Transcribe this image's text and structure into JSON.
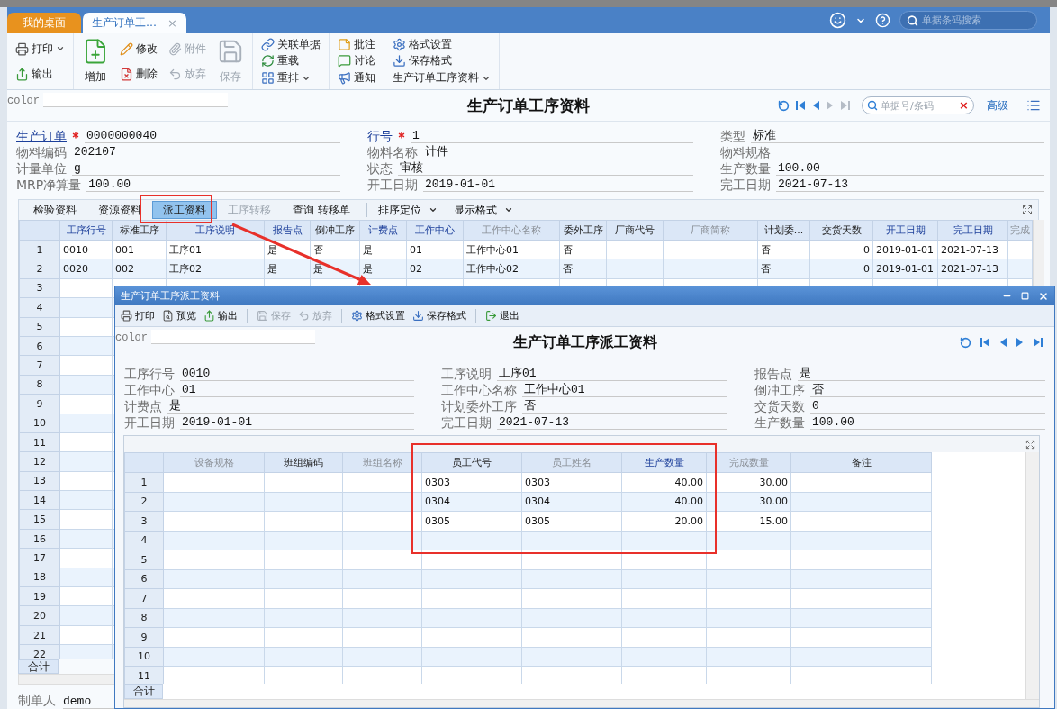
{
  "tabs": [
    {
      "label": "我的桌面",
      "selected": false
    },
    {
      "label": "生产订单工…",
      "selected": true,
      "close": "×"
    }
  ],
  "top_search": {
    "placeholder": "单据条码搜索"
  },
  "ribbon": [
    {
      "columns": [
        [
          {
            "label": "打印",
            "kind": "small",
            "disabled": false,
            "menu": true
          },
          {
            "label": "输出",
            "kind": "small",
            "disabled": false,
            "menu": false
          }
        ]
      ]
    },
    {
      "columns": [
        [
          {
            "label": "增加",
            "kind": "large",
            "disabled": false,
            "menu": false
          }
        ],
        [
          {
            "label": "修改",
            "kind": "small",
            "disabled": false,
            "menu": false
          },
          {
            "label": "删除",
            "kind": "small",
            "disabled": false,
            "menu": false
          }
        ],
        [
          {
            "label": "附件",
            "kind": "small",
            "disabled": true,
            "menu": false
          },
          {
            "label": "放弃",
            "kind": "small",
            "disabled": true,
            "menu": false
          }
        ],
        [
          {
            "label": "保存",
            "kind": "large",
            "disabled": true,
            "menu": false
          }
        ]
      ]
    },
    {
      "columns": [
        [
          {
            "label": "关联单据",
            "kind": "small",
            "disabled": false,
            "menu": false
          },
          {
            "label": "重载",
            "kind": "small",
            "disabled": false,
            "menu": false
          },
          {
            "label": "重排",
            "kind": "small",
            "disabled": false,
            "menu": true
          }
        ]
      ]
    },
    {
      "columns": [
        [
          {
            "label": "批注",
            "kind": "small",
            "disabled": false,
            "menu": false
          },
          {
            "label": "讨论",
            "kind": "small",
            "disabled": false,
            "menu": false
          },
          {
            "label": "通知",
            "kind": "small",
            "disabled": false,
            "menu": false
          }
        ]
      ]
    },
    {
      "columns": [
        [
          {
            "label": "格式设置",
            "kind": "small",
            "disabled": false,
            "menu": false
          },
          {
            "label": "保存格式",
            "kind": "small",
            "disabled": false,
            "menu": false
          },
          {
            "label": "生产订单工序资料",
            "kind": "plain",
            "disabled": false,
            "menu": true
          }
        ]
      ]
    }
  ],
  "header": {
    "color_label": "color",
    "title": "生产订单工序资料",
    "nav": [
      {
        "kind": "refresh",
        "disabled": false
      },
      {
        "kind": "first",
        "disabled": false
      },
      {
        "kind": "prev",
        "disabled": false
      },
      {
        "kind": "next",
        "disabled": true
      },
      {
        "kind": "last",
        "disabled": true
      }
    ],
    "search": {
      "placeholder": "单据号/条码",
      "clear": "×"
    },
    "advanced": "高级"
  },
  "form": {
    "columns": [
      [
        {
          "label": "生产订单",
          "value": "0000000040",
          "required": true,
          "link": true
        },
        {
          "label": "物料编码",
          "value": "202107",
          "required": false,
          "link": false
        },
        {
          "label": "计量单位",
          "value": "g",
          "required": false,
          "link": false
        },
        {
          "label": "MRP净算量",
          "value": "100.00",
          "required": false,
          "link": false
        }
      ],
      [
        {
          "label": "行号",
          "value": "1",
          "required": true,
          "link": false
        },
        {
          "label": "物料名称",
          "value": "计件",
          "required": false,
          "link": false
        },
        {
          "label": "状态",
          "value": "审核",
          "required": false,
          "link": false
        },
        {
          "label": "开工日期",
          "value": "2019-01-01",
          "required": false,
          "link": false
        }
      ],
      [
        {
          "label": "类型",
          "value": "标准",
          "required": false,
          "link": false
        },
        {
          "label": "物料规格",
          "required": false,
          "link": false
        },
        {
          "label": "生产数量",
          "value": "100.00",
          "required": false,
          "link": false
        },
        {
          "label": "完工日期",
          "value": "2021-07-13",
          "required": false,
          "link": false
        }
      ]
    ]
  },
  "sub_tabs": [
    {
      "label": "检验资料",
      "selected": false,
      "disabled": false
    },
    {
      "label": "资源资料",
      "selected": false,
      "disabled": false
    },
    {
      "label": "派工资料",
      "selected": true,
      "disabled": false
    },
    {
      "label": "工序转移",
      "selected": false,
      "disabled": true
    },
    {
      "label": "查询 转移单",
      "selected": false,
      "disabled": false
    }
  ],
  "sub_menus": [
    {
      "label": "排序定位"
    },
    {
      "label": "显示格式"
    }
  ],
  "grid": {
    "columns": [
      {
        "label": "工序行号",
        "highlight": true,
        "muted": false,
        "numeric": false
      },
      {
        "label": "标准工序",
        "highlight": false,
        "muted": false,
        "numeric": false
      },
      {
        "label": "工序说明",
        "highlight": true,
        "muted": false,
        "numeric": false
      },
      {
        "label": "报告点",
        "highlight": true,
        "muted": false,
        "numeric": false
      },
      {
        "label": "倒冲工序",
        "highlight": false,
        "muted": false,
        "numeric": false
      },
      {
        "label": "计费点",
        "highlight": true,
        "muted": false,
        "numeric": false
      },
      {
        "label": "工作中心",
        "highlight": true,
        "muted": false,
        "numeric": false
      },
      {
        "label": "工作中心名称",
        "highlight": false,
        "muted": true,
        "numeric": false
      },
      {
        "label": "委外工序",
        "highlight": false,
        "muted": false,
        "numeric": false
      },
      {
        "label": "厂商代号",
        "highlight": false,
        "muted": false
      },
      {
        "label": "厂商简称",
        "highlight": false,
        "muted": true
      },
      {
        "label": "计划委...",
        "highlight": false,
        "muted": false,
        "numeric": false
      },
      {
        "label": "交货天数",
        "highlight": false,
        "muted": false,
        "numeric": true
      },
      {
        "label": "开工日期",
        "highlight": true,
        "muted": false,
        "numeric": false
      },
      {
        "label": "完工日期",
        "highlight": true,
        "muted": false,
        "numeric": false
      },
      {
        "label": "完成",
        "highlight": false,
        "muted": true
      }
    ],
    "rows": [
      {
        "number": "1",
        "cells": [
          "0010",
          "001",
          "工序01",
          "是",
          "否",
          "是",
          "01",
          "工作中心01",
          "否",
          null,
          null,
          "否",
          "0",
          "2019-01-01",
          "2021-07-13",
          null
        ]
      },
      {
        "number": "2",
        "cells": [
          "0020",
          "002",
          "工序02",
          "是",
          "是",
          "是",
          "02",
          "工作中心02",
          "否",
          null,
          null,
          "否",
          "0",
          "2019-01-01",
          "2021-07-13",
          null
        ]
      },
      {
        "number": "3"
      },
      {
        "number": "4"
      },
      {
        "number": "5"
      },
      {
        "number": "6"
      },
      {
        "number": "7"
      },
      {
        "number": "8"
      },
      {
        "number": "9"
      },
      {
        "number": "10"
      },
      {
        "number": "11"
      },
      {
        "number": "12"
      },
      {
        "number": "13"
      },
      {
        "number": "14"
      },
      {
        "number": "15"
      },
      {
        "number": "16"
      },
      {
        "number": "17"
      },
      {
        "number": "18"
      },
      {
        "number": "19"
      },
      {
        "number": "20"
      },
      {
        "number": "21"
      },
      {
        "number": "22"
      }
    ],
    "total_label": "合计"
  },
  "footer": {
    "label": "制单人",
    "value": "demo"
  },
  "dialog": {
    "title": "生产订单工序派工资料",
    "toolbar": [
      [
        {
          "label": "打印",
          "disabled": false
        },
        {
          "label": "预览",
          "disabled": false
        },
        {
          "label": "输出",
          "disabled": false
        }
      ],
      [
        {
          "label": "保存",
          "disabled": true
        },
        {
          "label": "放弃",
          "disabled": true
        }
      ],
      [
        {
          "label": "格式设置",
          "disabled": false
        },
        {
          "label": "保存格式",
          "disabled": false
        }
      ],
      [
        {
          "label": "退出",
          "disabled": false
        }
      ]
    ],
    "color_label": "color",
    "heading": "生产订单工序派工资料",
    "nav": [
      {
        "kind": "refresh",
        "disabled": false
      },
      {
        "kind": "first",
        "disabled": false
      },
      {
        "kind": "prev",
        "disabled": false
      },
      {
        "kind": "next",
        "disabled": false
      },
      {
        "kind": "last",
        "disabled": false
      }
    ],
    "form": {
      "columns": [
        [
          {
            "label": "工序行号",
            "value": "0010",
            "required": false,
            "link": false
          },
          {
            "label": "工作中心",
            "value": "01",
            "required": false,
            "link": false
          },
          {
            "label": "计费点",
            "value": "是",
            "required": false,
            "link": false
          },
          {
            "label": "开工日期",
            "value": "2019-01-01",
            "required": false,
            "link": false
          }
        ],
        [
          {
            "label": "工序说明",
            "value": "工序01",
            "required": false,
            "link": false
          },
          {
            "label": "工作中心名称",
            "value": "工作中心01",
            "required": false,
            "link": false
          },
          {
            "label": "计划委外工序",
            "value": "否",
            "required": false,
            "link": false
          },
          {
            "label": "完工日期",
            "value": "2021-07-13",
            "required": false,
            "link": false
          }
        ],
        [
          {
            "label": "报告点",
            "value": "是",
            "required": false,
            "link": false
          },
          {
            "label": "倒冲工序",
            "value": "否",
            "required": false,
            "link": false
          },
          {
            "label": "交货天数",
            "value": "0",
            "required": false,
            "link": false
          },
          {
            "label": "生产数量",
            "value": "100.00",
            "required": false,
            "link": false
          }
        ]
      ]
    },
    "grid": {
      "columns": [
        {
          "label": "设备规格",
          "highlight": false,
          "muted": true
        },
        {
          "label": "班组编码",
          "highlight": false,
          "muted": false
        },
        {
          "label": "班组名称",
          "highlight": false,
          "muted": true
        },
        {
          "label": "员工代号",
          "highlight": false,
          "muted": false,
          "numeric": false
        },
        {
          "label": "员工姓名",
          "highlight": false,
          "muted": true,
          "numeric": false
        },
        {
          "label": "生产数量",
          "highlight": true,
          "muted": false,
          "numeric": true
        },
        {
          "label": "完成数量",
          "highlight": false,
          "muted": true,
          "numeric": true
        },
        {
          "label": "备注",
          "highlight": false,
          "muted": false
        }
      ],
      "rows": [
        {
          "number": "1",
          "cells": [
            null,
            null,
            null,
            "0303",
            "0303",
            "40.00",
            "30.00",
            null
          ]
        },
        {
          "number": "2",
          "cells": [
            null,
            null,
            null,
            "0304",
            "0304",
            "40.00",
            "30.00",
            null
          ]
        },
        {
          "number": "3",
          "cells": [
            null,
            null,
            null,
            "0305",
            "0305",
            "20.00",
            "15.00",
            null
          ]
        },
        {
          "number": "4"
        },
        {
          "number": "5"
        },
        {
          "number": "6"
        },
        {
          "number": "7"
        },
        {
          "number": "8"
        },
        {
          "number": "9"
        },
        {
          "number": "10"
        },
        {
          "number": "11"
        }
      ],
      "total_label": "合计"
    }
  }
}
